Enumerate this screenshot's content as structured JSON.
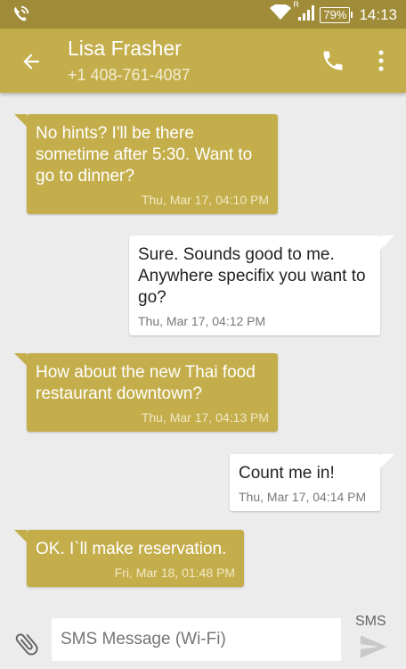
{
  "status_bar": {
    "battery": "79%",
    "time": "14:13",
    "roaming": "R"
  },
  "header": {
    "contact_name": "Lisa Frasher",
    "phone_number": "+1 408-761-4087"
  },
  "messages": [
    {
      "direction": "incoming",
      "text": "No hints?  I'll be there sometime after 5:30.  Want to go to dinner?",
      "timestamp": "Thu, Mar 17, 04:10 PM"
    },
    {
      "direction": "outgoing",
      "text": "Sure. Sounds good to me. Anywhere specifix you want to go?",
      "timestamp": "Thu, Mar 17, 04:12 PM"
    },
    {
      "direction": "incoming",
      "text": "How about the new Thai food restaurant downtown?",
      "timestamp": "Thu, Mar 17, 04:13 PM"
    },
    {
      "direction": "outgoing",
      "text": "Count me in!",
      "timestamp": "Thu, Mar 17, 04:14 PM"
    },
    {
      "direction": "incoming",
      "text": "OK. I`ll make reservation.",
      "timestamp": "Fri, Mar 18, 01:48 PM"
    }
  ],
  "composer": {
    "placeholder": "SMS Message (Wi-Fi)",
    "send_label": "SMS"
  },
  "colors": {
    "accent": "#c4ae4c",
    "status_bar": "#a08c38",
    "background": "#ececec"
  },
  "icons": [
    "wifi-calling-icon",
    "wifi-icon",
    "signal-icon",
    "battery-icon",
    "back-arrow-icon",
    "phone-icon",
    "more-vert-icon",
    "paperclip-icon",
    "send-icon"
  ]
}
